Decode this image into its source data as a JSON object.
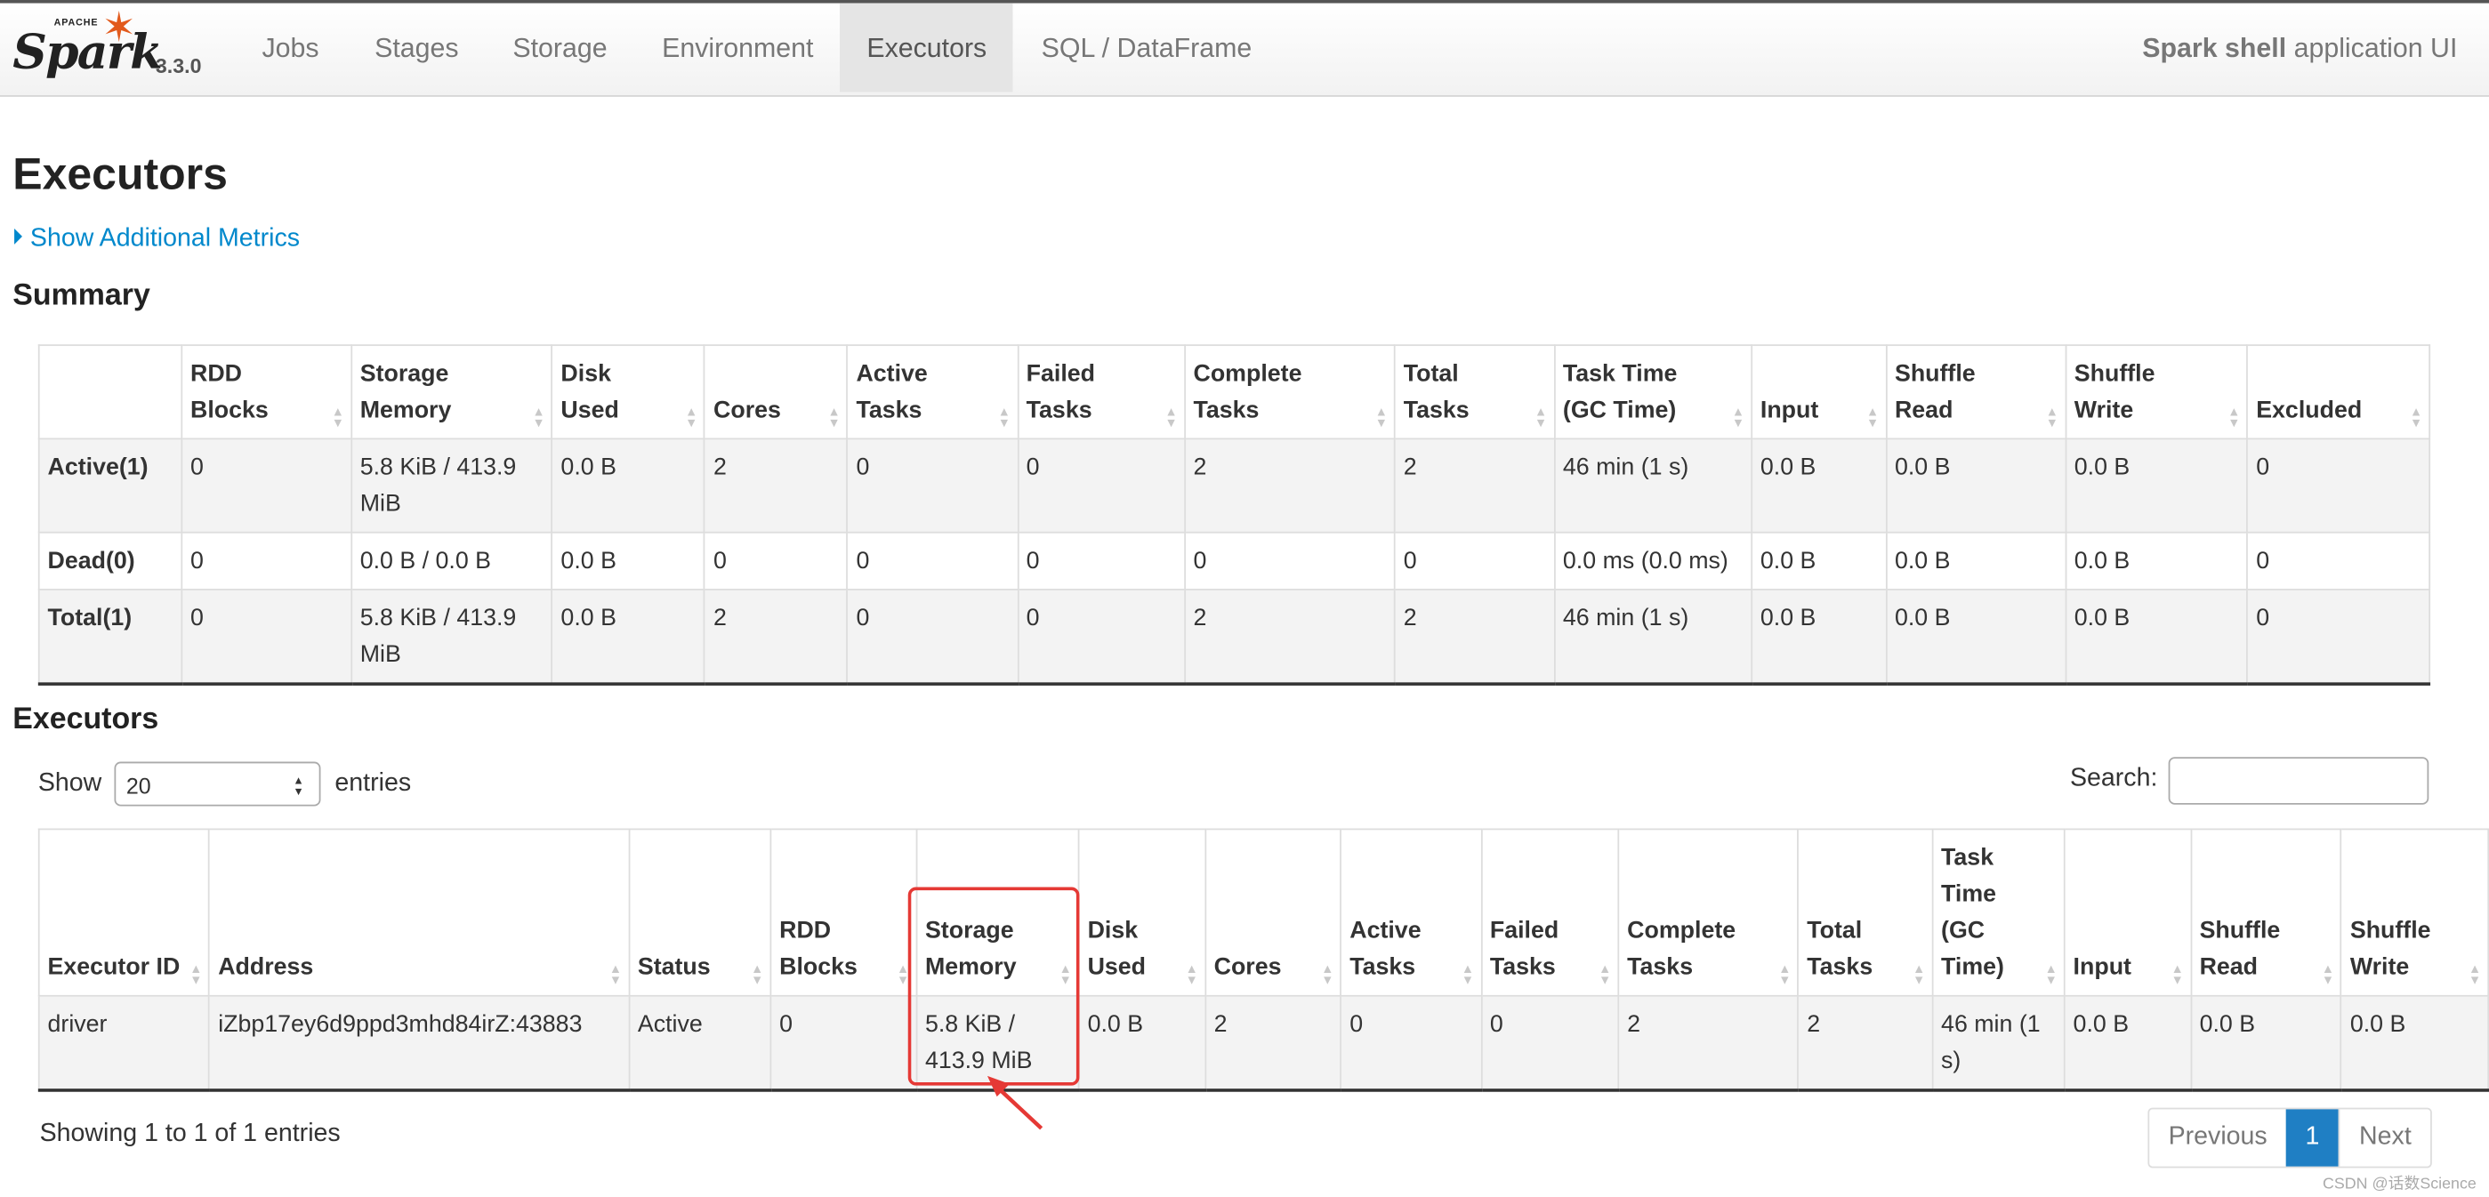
{
  "nav": {
    "brand_small": "APACHE",
    "brand": "Spark",
    "version": "3.3.0",
    "items": [
      "Jobs",
      "Stages",
      "Storage",
      "Environment",
      "Executors",
      "SQL / DataFrame"
    ],
    "active": "Executors",
    "app_title_bold": "Spark shell",
    "app_title_rest": " application UI"
  },
  "page_title": "Executors",
  "additional_metrics": "Show Additional Metrics",
  "summary": {
    "heading": "Summary",
    "headers": [
      "",
      "RDD Blocks",
      "Storage Memory",
      "Disk Used",
      "Cores",
      "Active Tasks",
      "Failed Tasks",
      "Complete Tasks",
      "Total Tasks",
      "Task Time (GC Time)",
      "Input",
      "Shuffle Read",
      "Shuffle Write",
      "Excluded"
    ],
    "rows": [
      [
        "Active(1)",
        "0",
        "5.8 KiB / 413.9 MiB",
        "0.0 B",
        "2",
        "0",
        "0",
        "2",
        "2",
        "46 min (1 s)",
        "0.0 B",
        "0.0 B",
        "0.0 B",
        "0"
      ],
      [
        "Dead(0)",
        "0",
        "0.0 B / 0.0 B",
        "0.0 B",
        "0",
        "0",
        "0",
        "0",
        "0",
        "0.0 ms (0.0 ms)",
        "0.0 B",
        "0.0 B",
        "0.0 B",
        "0"
      ],
      [
        "Total(1)",
        "0",
        "5.8 KiB / 413.9 MiB",
        "0.0 B",
        "2",
        "0",
        "0",
        "2",
        "2",
        "46 min (1 s)",
        "0.0 B",
        "0.0 B",
        "0.0 B",
        "0"
      ]
    ]
  },
  "executors": {
    "heading": "Executors",
    "show_label": "Show",
    "entries_value": "20",
    "entries_label": "entries",
    "search_label": "Search:",
    "headers": [
      "Executor ID",
      "Address",
      "Status",
      "RDD Blocks",
      "Storage Memory",
      "Disk Used",
      "Cores",
      "Active Tasks",
      "Failed Tasks",
      "Complete Tasks",
      "Total Tasks",
      "Task Time (GC Time)",
      "Input",
      "Shuffle Read",
      "Shuffle Write"
    ],
    "rows": [
      [
        "driver",
        "iZbp17ey6d9ppd3mhd84irZ:43883",
        "Active",
        "0",
        "5.8 KiB / 413.9 MiB",
        "0.0 B",
        "2",
        "0",
        "0",
        "2",
        "2",
        "46 min (1 s)",
        "0.0 B",
        "0.0 B",
        "0.0 B"
      ]
    ],
    "footer": "Showing 1 to 1 of 1 entries",
    "pager": {
      "previous": "Previous",
      "current": "1",
      "next": "Next"
    }
  },
  "watermark": "CSDN @话数Science",
  "colors": {
    "accent": "#0088cc",
    "highlight": "#e53935",
    "pager_active": "#1f7fc4"
  }
}
